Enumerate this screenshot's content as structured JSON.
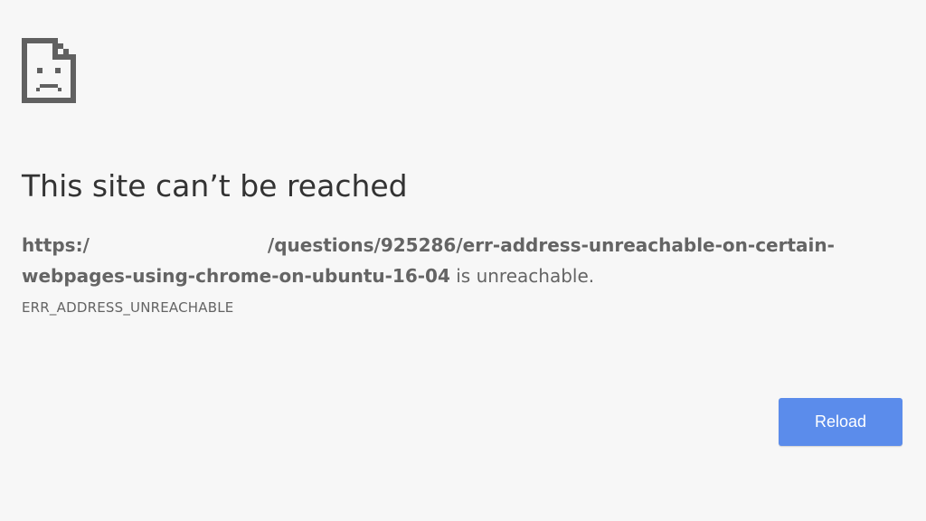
{
  "error": {
    "icon": "sad-page-icon",
    "title": "This site can’t be reached",
    "url_prefix": "https:/",
    "url_suffix": "/questions/925286/err-address-unreachable-on-certain-webpages-using-chrome-on-ubuntu-16-04",
    "message_tail": " is unreachable.",
    "code": "ERR_ADDRESS_UNREACHABLE"
  },
  "actions": {
    "reload_label": "Reload"
  },
  "colors": {
    "background": "#f7f7f7",
    "title_text": "#333333",
    "body_text": "#646464",
    "button": "#5b8ceb",
    "button_text": "#ffffff"
  }
}
